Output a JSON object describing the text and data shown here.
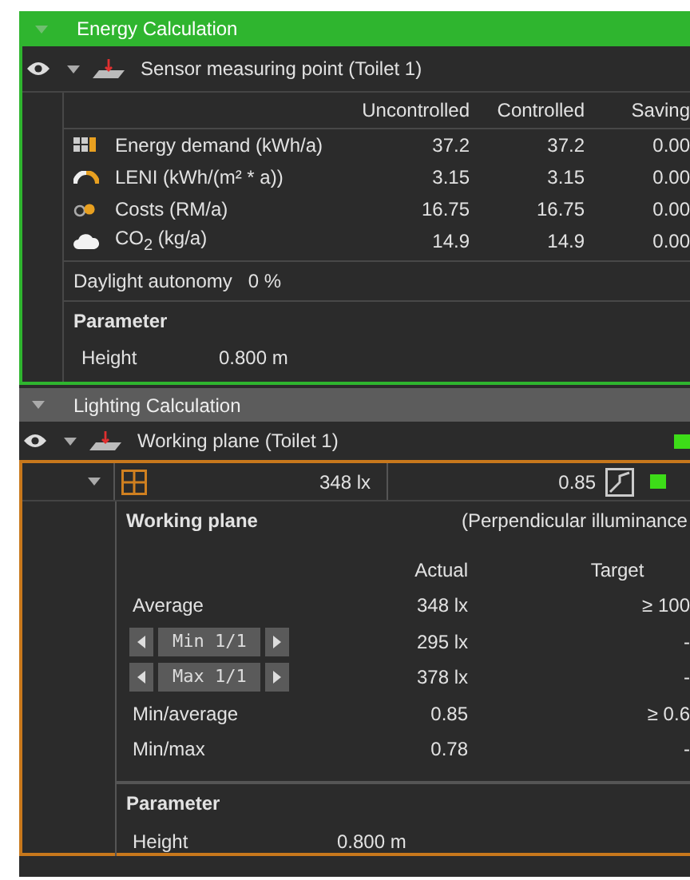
{
  "energy": {
    "title": "Energy Calculation",
    "object": "Sensor measuring point (Toilet 1)",
    "columns": [
      "Uncontrolled",
      "Controlled",
      "Saving"
    ],
    "rows": [
      {
        "kind": "energy",
        "label": "Energy demand (kWh/a)",
        "values": [
          "37.2",
          "37.2",
          "0.00"
        ]
      },
      {
        "kind": "leni",
        "label": "LENI (kWh/(m² * a))",
        "values": [
          "3.15",
          "3.15",
          "0.00"
        ]
      },
      {
        "kind": "costs",
        "label": "Costs (RM/a)",
        "values": [
          "16.75",
          "16.75",
          "0.00"
        ]
      },
      {
        "kind": "co2",
        "label": "CO$_{2}$ (kg/a)",
        "values": [
          "14.9",
          "14.9",
          "0.00"
        ]
      }
    ],
    "daylight": {
      "label": "Daylight autonomy",
      "value": "0 %"
    },
    "parameter": {
      "title": "Parameter",
      "label": "Height",
      "value": "0.800 m"
    }
  },
  "lighting": {
    "title": "Lighting Calculation",
    "object": "Working plane (Toilet 1)",
    "summary": {
      "illuminance": "348 lx",
      "uniformity": "0.85"
    },
    "plane": {
      "title": "Working plane",
      "note": "(Perpendicular illuminance",
      "columns": [
        "Actual",
        "Target"
      ],
      "rows": [
        {
          "kind": "plain",
          "label": "Average",
          "actual": "348 lx",
          "target": "≥ 100"
        },
        {
          "kind": "stepper",
          "label": "Min 1/1",
          "actual": "295 lx",
          "target": "-"
        },
        {
          "kind": "stepper",
          "label": "Max 1/1",
          "actual": "378 lx",
          "target": "-"
        },
        {
          "kind": "plain",
          "label": "Min/average",
          "actual": "0.85",
          "target": "≥ 0.6"
        },
        {
          "kind": "plain",
          "label": "Min/max",
          "actual": "0.78",
          "target": "-"
        }
      ]
    },
    "parameter": {
      "title": "Parameter",
      "label": "Height",
      "value": "0.800 m"
    }
  }
}
